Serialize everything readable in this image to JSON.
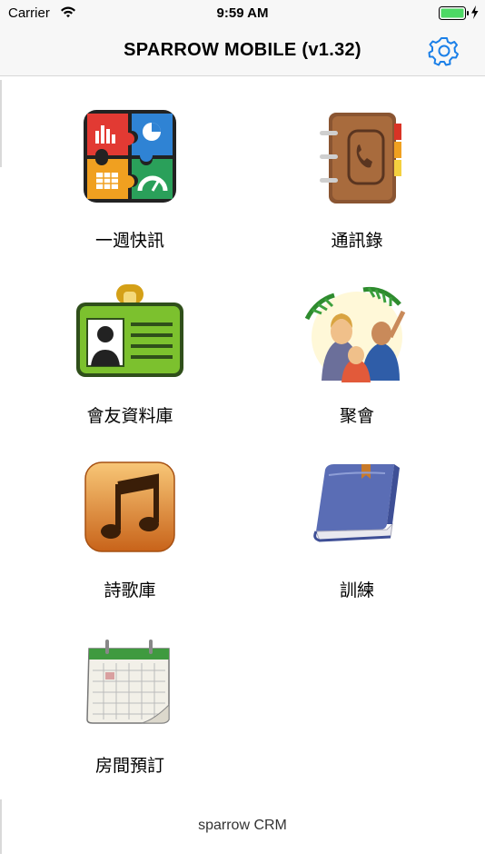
{
  "status_bar": {
    "carrier": "Carrier",
    "time": "9:59 AM"
  },
  "nav": {
    "title": "SPARROW MOBILE (v1.32)",
    "settings_icon": "gear-icon"
  },
  "menu": [
    {
      "label": "一週快訊",
      "icon": "weekly-news-puzzle-icon"
    },
    {
      "label": "通訊錄",
      "icon": "address-book-icon"
    },
    {
      "label": "會友資料庫",
      "icon": "member-id-card-icon"
    },
    {
      "label": "聚會",
      "icon": "gathering-people-icon"
    },
    {
      "label": "詩歌庫",
      "icon": "music-note-icon"
    },
    {
      "label": "訓練",
      "icon": "training-book-icon"
    },
    {
      "label": "房間預訂",
      "icon": "room-booking-calendar-icon"
    }
  ],
  "footer": {
    "text": "sparrow CRM"
  },
  "colors": {
    "accent": "#1a7fe8",
    "battery": "#4cd964"
  }
}
